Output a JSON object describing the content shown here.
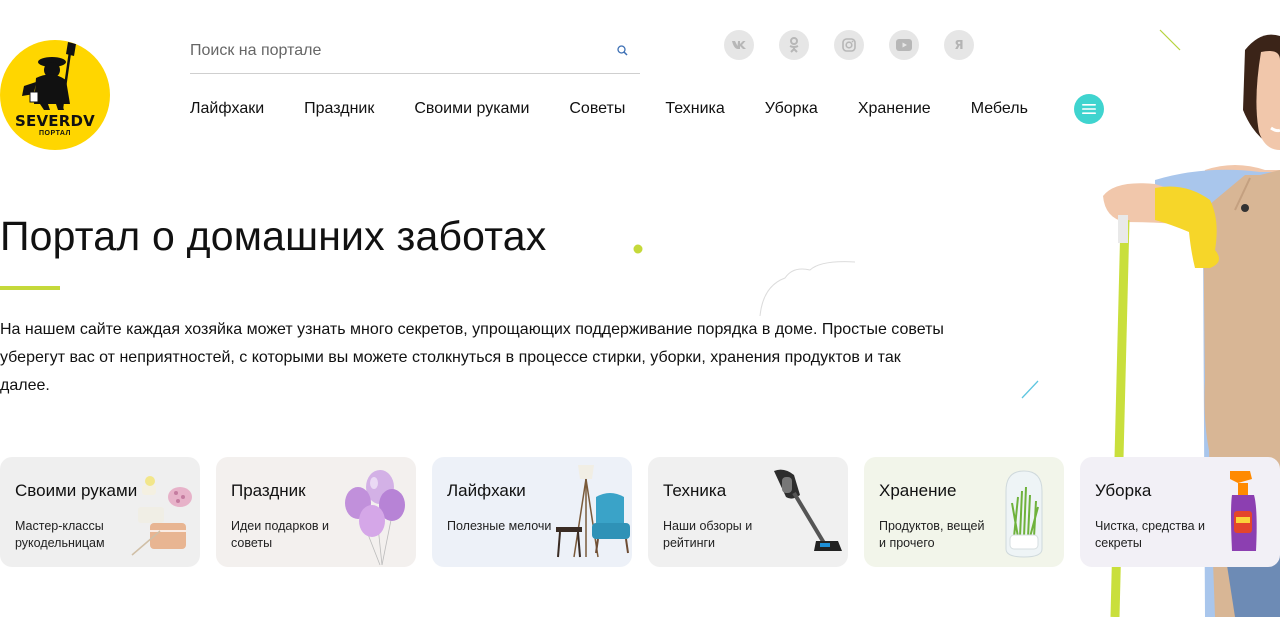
{
  "logo": {
    "name": "SEVERDV",
    "sub": "ПОРТАЛ"
  },
  "search": {
    "placeholder": "Поиск на портале"
  },
  "socials": [
    {
      "icon": "vk-icon",
      "label": "vk"
    },
    {
      "icon": "odnoklassniki-icon",
      "label": "ok"
    },
    {
      "icon": "instagram-icon",
      "label": "instagram"
    },
    {
      "icon": "youtube-icon",
      "label": "youtube"
    },
    {
      "icon": "yandex-icon",
      "label": "Я"
    }
  ],
  "nav": [
    "Лайфхаки",
    "Праздник",
    "Своими руками",
    "Советы",
    "Техника",
    "Уборка",
    "Хранение",
    "Мебель"
  ],
  "hero": {
    "title": "Портал о домашних заботах",
    "description": "На нашем сайте каждая хозяйка может узнать много секретов, упрощающих поддерживание порядка в доме. Простые советы уберегут вас от неприятностей, с которыми вы можете столкнуться в процессе стирки, уборки, хранения продуктов и так далее."
  },
  "cards": [
    {
      "title": "Своими руками",
      "sub": "Мастер-классы рукодельницам",
      "bg": "#efefef",
      "image": "crafts"
    },
    {
      "title": "Праздник",
      "sub": "Идеи подарков и советы",
      "bg": "#f3f0ee",
      "image": "balloons"
    },
    {
      "title": "Лайфхаки",
      "sub": "Полезные мелочи",
      "bg": "#edf1f8",
      "image": "furniture"
    },
    {
      "title": "Техника",
      "sub": "Наши обзоры и рейтинги",
      "bg": "#f0f0f0",
      "image": "vacuum"
    },
    {
      "title": "Хранение",
      "sub": "Продуктов, вещей и прочего",
      "bg": "#f2f5ea",
      "image": "jar"
    },
    {
      "title": "Уборка",
      "sub": "Чистка, средства и секреты",
      "bg": "#f2f0f6",
      "image": "spray"
    }
  ],
  "colors": {
    "accent": "#c5d93a",
    "menu": "#3fd4cf",
    "logo": "#ffd600"
  }
}
